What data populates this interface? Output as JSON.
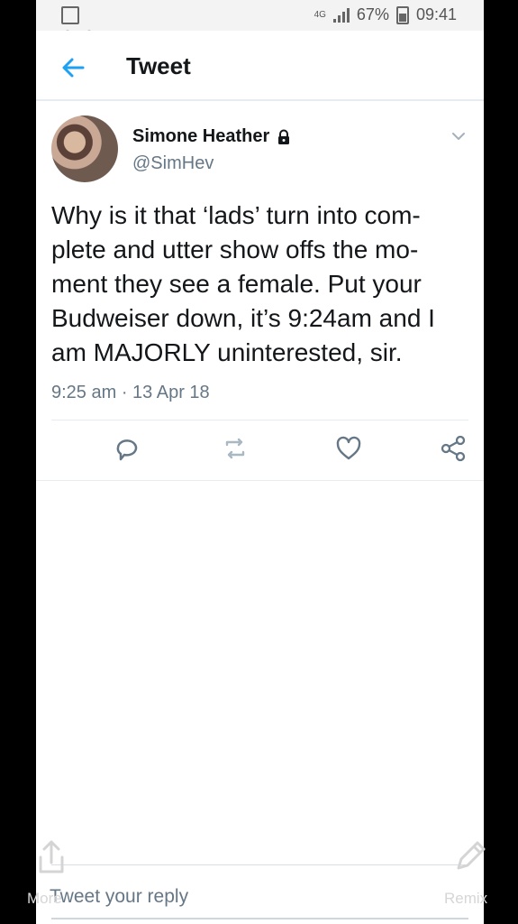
{
  "status_bar": {
    "battery": "67%",
    "time": "09:41",
    "network": "4G"
  },
  "header": {
    "title": "Tweet"
  },
  "tweet": {
    "name": "Simone Heather",
    "handle": "@SimHev",
    "text": "Why is it that ‘lads’ turn into com-plete and utter show offs the mo-ment they see a female. Put your Budweiser down, it’s 9:24am and I am MAJORLY uninterested, sir.",
    "time": "9:25 am · 13 Apr 18"
  },
  "reply": {
    "placeholder": "Tweet your reply"
  },
  "overlay": {
    "more_label": "More",
    "remix_label": "Remix"
  },
  "colors": {
    "accent": "#1da1f2",
    "text": "#14171a",
    "muted": "#657786"
  },
  "icons": [
    "close-icon",
    "back-arrow-icon",
    "lock-icon",
    "chevron-down-icon",
    "reply-icon",
    "retweet-icon",
    "like-icon",
    "share-icon",
    "share-overlay-icon",
    "edit-overlay-icon"
  ]
}
